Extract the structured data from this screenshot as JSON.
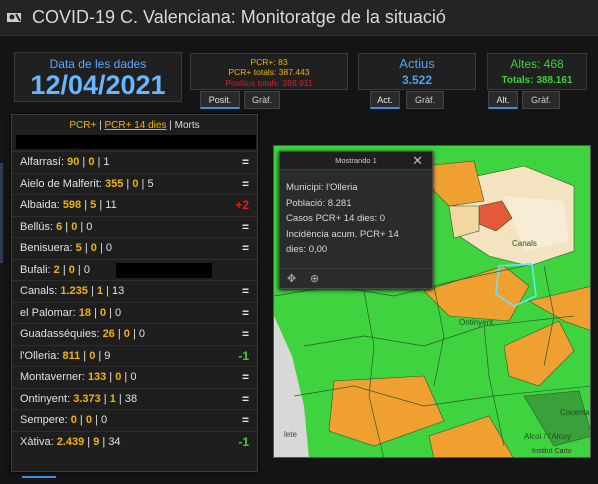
{
  "header": {
    "title": "COVID-19 C. Valenciana: Monitoratge de la situació",
    "logo_icon": "virus-logo-icon"
  },
  "date_card": {
    "label": "Data de les dades",
    "value": "12/04/2021"
  },
  "pcr_card": {
    "line1": "PCR+: 83",
    "line2": "PCR+ totals: 387.443",
    "line3": "Positius totals: 398.911"
  },
  "active_card": {
    "label": "Actius",
    "value": "3.522"
  },
  "recovered_card": {
    "label": "Altes: 468",
    "value": "Totals: 388.161"
  },
  "tabs": {
    "pcr": [
      "Posit.",
      "Gràf."
    ],
    "active": [
      "Act.",
      "Gràf."
    ],
    "recovered": [
      "Alt.",
      "Gràf."
    ]
  },
  "list_panel": {
    "tab1": "PCR+",
    "sep1": " | ",
    "tab2": "PCR+ 14 dies",
    "sep2": " | ",
    "tab3": "Morts",
    "rows": [
      {
        "name": "Alfarrasí: ",
        "a": "90",
        "b": "0",
        "c": "1",
        "trend": "=",
        "trend_type": "same"
      },
      {
        "name": "Aielo de Malferit: ",
        "a": "355",
        "b": "0",
        "c": "5",
        "trend": "=",
        "trend_type": "same"
      },
      {
        "name": "Albaida: ",
        "a": "598",
        "b": "5",
        "c": "11",
        "trend": "+2",
        "trend_type": "up"
      },
      {
        "name": "Bellús: ",
        "a": "6",
        "b": "0",
        "c": "0",
        "trend": "=",
        "trend_type": "same"
      },
      {
        "name": "Benisuera: ",
        "a": "5",
        "b": "0",
        "c": "0",
        "trend": "=",
        "trend_type": "same"
      },
      {
        "name": "Bufali: ",
        "a": "2",
        "b": "0",
        "c": "0",
        "trend": "",
        "trend_type": "redacted"
      },
      {
        "name": "Canals: ",
        "a": "1.235",
        "b": "1",
        "c": "13",
        "trend": "=",
        "trend_type": "same"
      },
      {
        "name": "el Palomar: ",
        "a": "18",
        "b": "0",
        "c": "0",
        "trend": "=",
        "trend_type": "same"
      },
      {
        "name": "Guadasséquies: ",
        "a": "26",
        "b": "0",
        "c": "0",
        "trend": "=",
        "trend_type": "same"
      },
      {
        "name": "l'Olleria: ",
        "a": "811",
        "b": "0",
        "c": "9",
        "trend": "-1",
        "trend_type": "down"
      },
      {
        "name": "Montaverner: ",
        "a": "133",
        "b": "0",
        "c": "0",
        "trend": "=",
        "trend_type": "same"
      },
      {
        "name": "Ontinyent: ",
        "a": "3.373",
        "b": "1",
        "c": "38",
        "trend": "=",
        "trend_type": "same"
      },
      {
        "name": "Sempere: ",
        "a": "0",
        "b": "0",
        "c": "0",
        "trend": "=",
        "trend_type": "same"
      },
      {
        "name": "Xàtiva: ",
        "a": "2.439",
        "b": "9",
        "c": "34",
        "trend": "-1",
        "trend_type": "down"
      }
    ]
  },
  "popup": {
    "caption": "Mostrando 1",
    "municipi": "Municipi: l'Olleria",
    "poblacio": "Població: 8.281",
    "casos": "Casos PCR+ 14 dies: 0",
    "incidencia": "Incidència acum. PCR+ 14",
    "incidencia2": "dies: 0,00",
    "close_icon": "close-icon",
    "move_icon": "move-icon",
    "zoom_icon": "zoom-icon"
  },
  "map": {
    "labels": {
      "canals": "Canals",
      "ontinyent": "Ontinyent",
      "cocentaina": "Cocenta",
      "alcoi": "Alcoi / l'Alcoy",
      "credit": "Institut Carto",
      "left": "lete"
    }
  },
  "colors": {
    "green": "#3fd33f",
    "orange": "#f0a030",
    "beige": "#f3e3c0",
    "red": "#e35a3a"
  }
}
